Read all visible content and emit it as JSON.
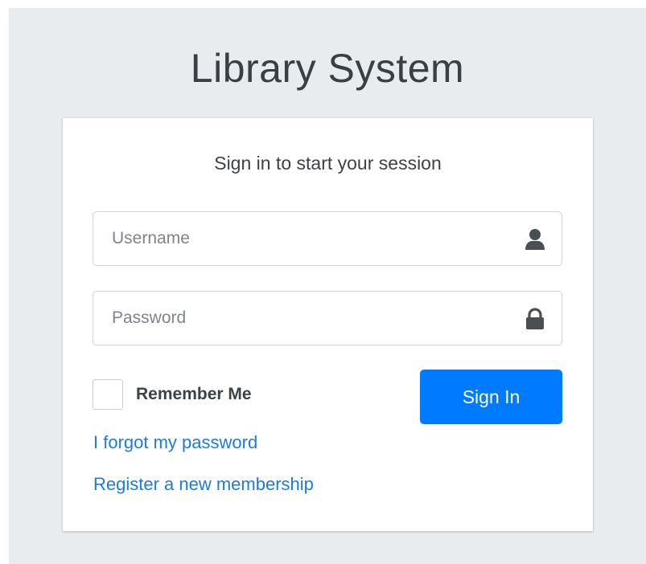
{
  "header": {
    "title": "Library System"
  },
  "login": {
    "message": "Sign in to start your session",
    "username_placeholder": "Username",
    "password_placeholder": "Password",
    "remember_label": "Remember Me",
    "submit_label": "Sign In",
    "forgot_link": "I forgot my password",
    "register_link": "Register a new membership"
  },
  "icons": {
    "username": "user-icon",
    "password": "lock-icon"
  },
  "colors": {
    "primary": "#007bff",
    "link": "#1d7bdb",
    "background": "#e9ecef"
  }
}
